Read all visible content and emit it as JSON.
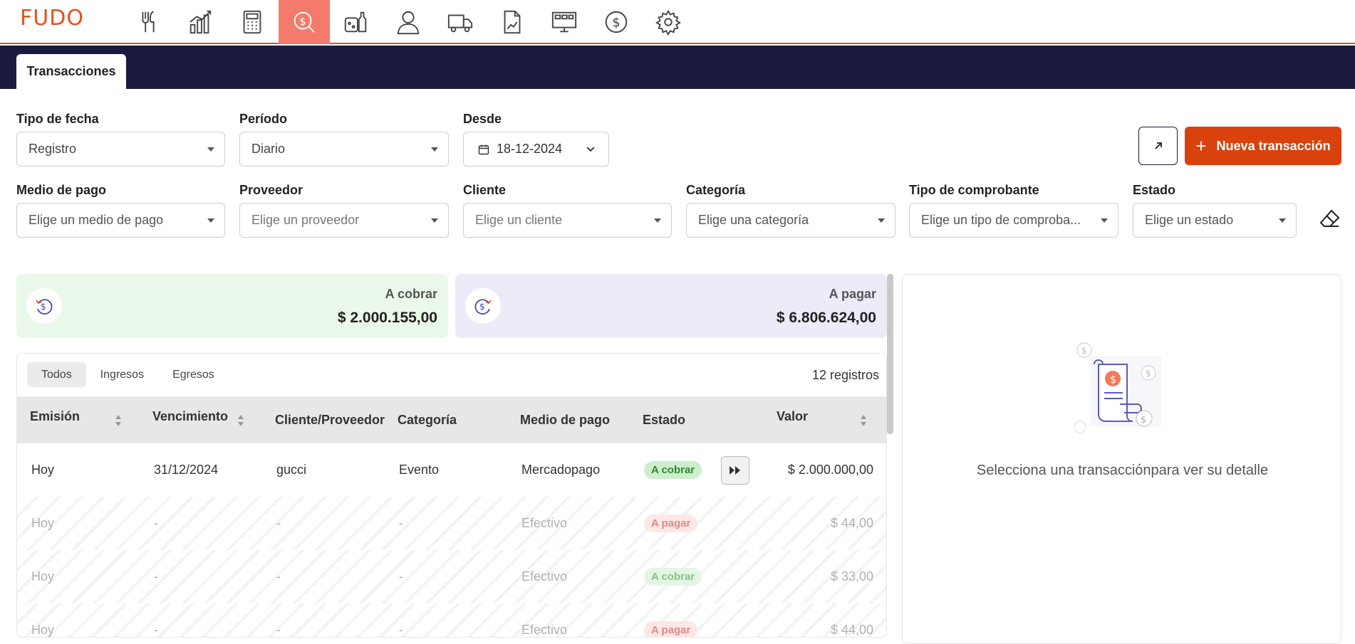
{
  "brand": {
    "logo": "FUDO",
    "accent": "#e2521c",
    "nav_dark": "#1b1b3f"
  },
  "nav": [
    {
      "icon": "utensils-icon"
    },
    {
      "icon": "bar-chart-icon"
    },
    {
      "icon": "calculator-icon"
    },
    {
      "icon": "dollar-search-icon",
      "active": true
    },
    {
      "icon": "grocery-icon"
    },
    {
      "icon": "user-icon"
    },
    {
      "icon": "truck-icon"
    },
    {
      "icon": "report-icon"
    },
    {
      "icon": "monitor-icon"
    },
    {
      "icon": "dollar-circle-icon"
    },
    {
      "icon": "gear-icon"
    }
  ],
  "tabs": {
    "active": "Transacciones"
  },
  "filters": {
    "tipo_fecha": {
      "label": "Tipo de fecha",
      "value": "Registro"
    },
    "periodo": {
      "label": "Período",
      "value": "Diario"
    },
    "desde": {
      "label": "Desde",
      "value": "18-12-2024"
    },
    "medio_pago": {
      "label": "Medio de pago",
      "placeholder": "Elige un medio de pago"
    },
    "proveedor": {
      "label": "Proveedor",
      "placeholder": "Elige un proveedor"
    },
    "cliente": {
      "label": "Cliente",
      "placeholder": "Elige un cliente"
    },
    "categoria": {
      "label": "Categoría",
      "placeholder": "Elige una categoría"
    },
    "tipo_comprobante": {
      "label": "Tipo de comprobante",
      "placeholder": "Elige un tipo de comproba..."
    },
    "estado": {
      "label": "Estado",
      "placeholder": "Elige un estado"
    }
  },
  "actions": {
    "new_transaction": "Nueva transacción"
  },
  "summary": {
    "cobrar": {
      "label": "A cobrar",
      "value": "$ 2.000.155,00"
    },
    "pagar": {
      "label": "A pagar",
      "value": "$ 6.806.624,00"
    }
  },
  "table": {
    "segments": [
      "Todos",
      "Ingresos",
      "Egresos"
    ],
    "count": "12 registros",
    "headers": [
      "Emisión",
      "Vencimiento",
      "Cliente/Proveedor",
      "Categoría",
      "Medio de pago",
      "Estado",
      "Valor"
    ],
    "rows": [
      {
        "emision": "Hoy",
        "vencimiento": "31/12/2024",
        "cliente": "gucci",
        "categoria": "Evento",
        "medio": "Mercadopago",
        "estado": "A cobrar",
        "valor": "$ 2.000.000,00"
      },
      {
        "emision": "Hoy",
        "vencimiento": "-",
        "cliente": "-",
        "categoria": "-",
        "medio": "Efectivo",
        "estado": "A pagar",
        "valor": "$ 44,00"
      },
      {
        "emision": "Hoy",
        "vencimiento": "-",
        "cliente": "-",
        "categoria": "-",
        "medio": "Efectivo",
        "estado": "A cobrar",
        "valor": "$ 33,00"
      },
      {
        "emision": "Hoy",
        "vencimiento": "-",
        "cliente": "-",
        "categoria": "-",
        "medio": "Efectivo",
        "estado": "A pagar",
        "valor": "$ 44,00"
      }
    ]
  },
  "detail": {
    "message": "Selecciona una transacciónpara ver su detalle"
  }
}
